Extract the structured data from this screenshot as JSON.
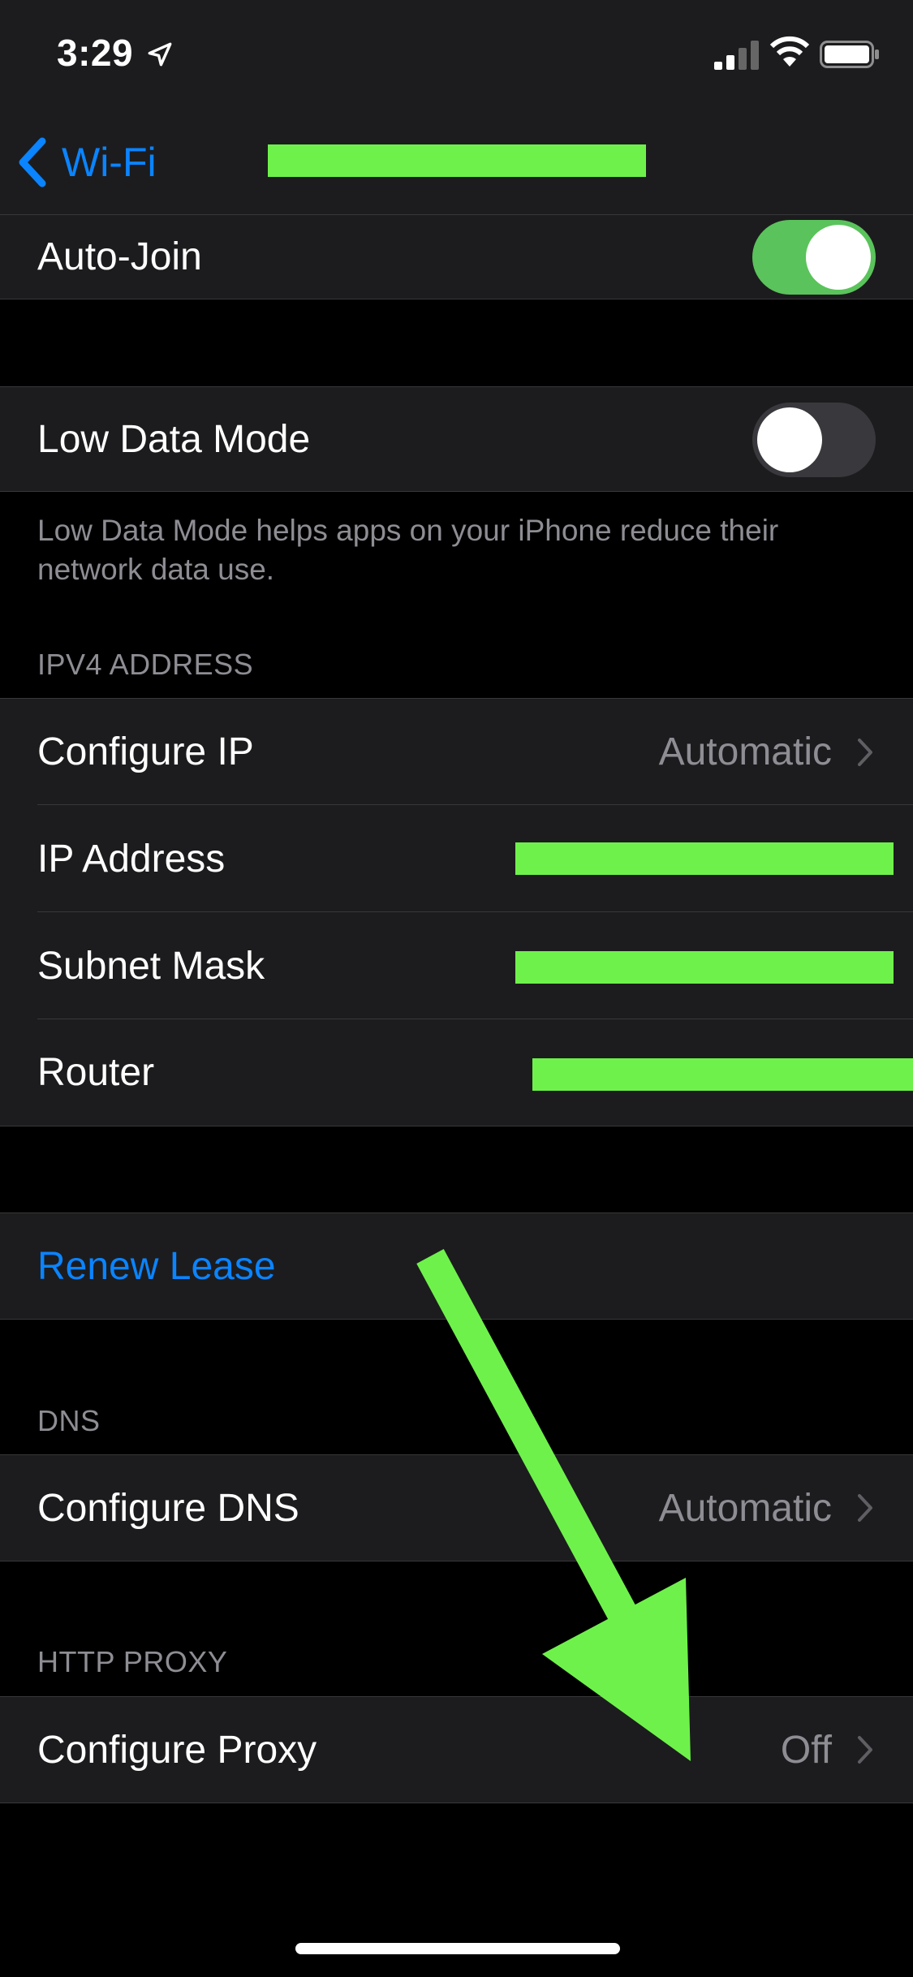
{
  "status_bar": {
    "time": "3:29"
  },
  "nav": {
    "back_label": "Wi-Fi"
  },
  "auto_join": {
    "label": "Auto-Join",
    "enabled": true
  },
  "low_data": {
    "label": "Low Data Mode",
    "enabled": false,
    "footer": "Low Data Mode helps apps on your iPhone reduce their network data use."
  },
  "ipv4": {
    "header": "IPV4 ADDRESS",
    "configure_ip": {
      "label": "Configure IP",
      "value": "Automatic"
    },
    "ip_address": {
      "label": "IP Address"
    },
    "subnet_mask": {
      "label": "Subnet Mask"
    },
    "router": {
      "label": "Router"
    }
  },
  "renew": {
    "label": "Renew Lease"
  },
  "dns": {
    "header": "DNS",
    "configure": {
      "label": "Configure DNS",
      "value": "Automatic"
    }
  },
  "proxy": {
    "header": "HTTP PROXY",
    "configure": {
      "label": "Configure Proxy",
      "value": "Off"
    }
  },
  "colors": {
    "accent": "#0a84ff",
    "toggle_on": "#5ac35b",
    "annotation": "#6ef24b"
  }
}
